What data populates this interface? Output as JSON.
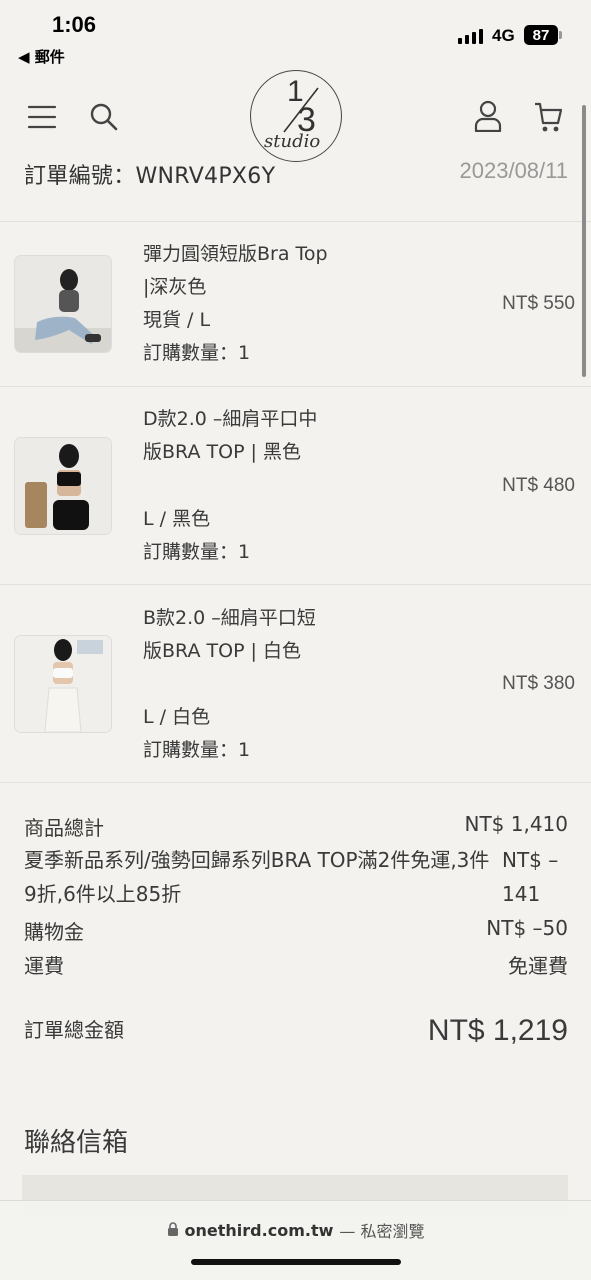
{
  "status_bar": {
    "time": "1:06",
    "back_label": "◀ 郵件",
    "network": "4G",
    "battery": "87"
  },
  "header": {
    "logo_top": "1",
    "logo_bottom": "3",
    "logo_text": "studio",
    "icons": [
      "menu-icon",
      "search-icon",
      "user-icon",
      "cart-icon"
    ]
  },
  "order": {
    "number_label": "訂單編號：WNRV4PX6Y",
    "date": "2023/08/11"
  },
  "items": [
    {
      "name": "彈力圓領短版Bra Top |深灰色",
      "variant": "現貨 / L",
      "qty": "訂購數量：1",
      "price": "NT$ 550"
    },
    {
      "name": "D款2.0 –細肩平口中版BRA TOP | 黑色",
      "variant": "L / 黑色",
      "qty": "訂購數量：1",
      "price": "NT$ 480"
    },
    {
      "name": "B款2.0 –細肩平口短版BRA TOP | 白色",
      "variant": "L / 白色",
      "qty": "訂購數量：1",
      "price": "NT$ 380"
    }
  ],
  "summary": {
    "subtotal_label": "商品總計",
    "subtotal_value": "NT$ 1,410",
    "discount_label": "夏季新品系列/強勢回歸系列BRA TOP滿2件免運,3件9折,6件以上85折",
    "discount_value": "NT$ –141",
    "credit_label": "購物金",
    "credit_value": "NT$ –50",
    "shipping_label": "運費",
    "shipping_value": "免運費",
    "total_label": "訂單總金額",
    "total_value": "NT$ 1,219"
  },
  "contact": {
    "heading": "聯絡信箱"
  },
  "browser": {
    "domain": "onethird.com.tw",
    "mode": "— 私密瀏覽"
  }
}
